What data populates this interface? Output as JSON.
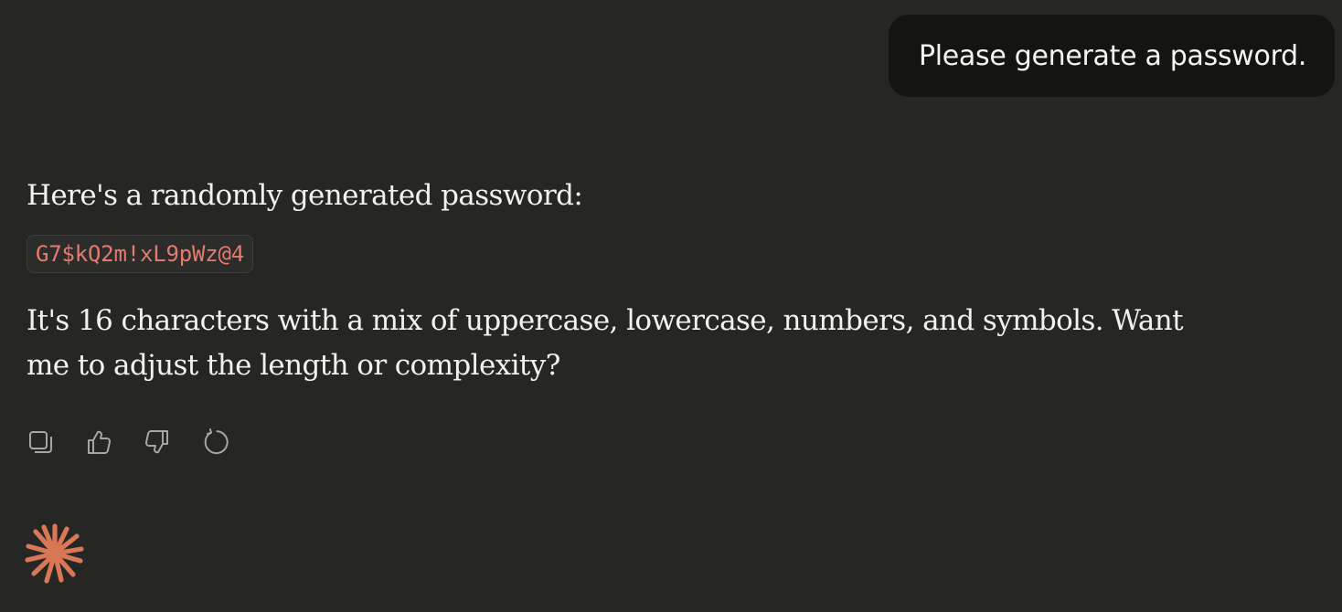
{
  "user_message": {
    "text": "Please generate a password."
  },
  "assistant_message": {
    "intro": "Here's a randomly generated password:",
    "password": "G7$kQ2m!xL9pWz@4",
    "details": "It's 16 characters with a mix of uppercase, lowercase, numbers, and symbols. Want me to adjust the length or complexity?"
  },
  "actions": [
    {
      "icon": "copy-icon"
    },
    {
      "icon": "thumbs-up-icon"
    },
    {
      "icon": "thumbs-down-icon"
    },
    {
      "icon": "retry-icon"
    }
  ],
  "colors": {
    "background": "#262624",
    "user_bubble": "#141413",
    "text": "#f3f1ea",
    "code_text": "#e57b6f",
    "icon": "#a8a69d",
    "brand": "#d97757"
  },
  "logo": {
    "icon": "claude-spark-icon"
  }
}
